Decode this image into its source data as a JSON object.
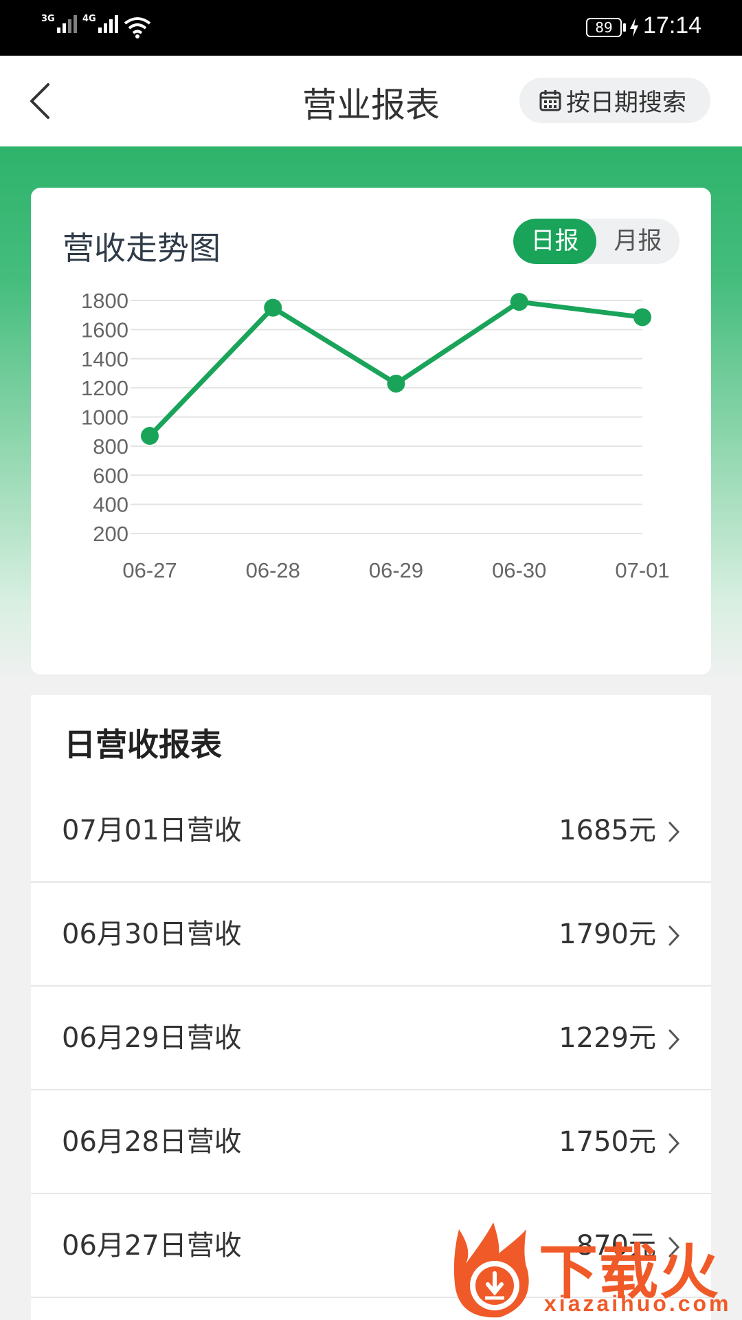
{
  "status_bar": {
    "network_1": "3G",
    "network_2": "4G",
    "battery": "89",
    "time": "17:14"
  },
  "header": {
    "title": "营业报表",
    "date_search_label": "按日期搜索"
  },
  "chart_card": {
    "title": "营收走势图",
    "toggle_daily": "日报",
    "toggle_monthly": "月报",
    "active_toggle": "日报"
  },
  "chart_data": {
    "type": "line",
    "title": "营收走势图",
    "categories": [
      "06-27",
      "06-28",
      "06-29",
      "06-30",
      "07-01"
    ],
    "values": [
      870,
      1750,
      1229,
      1790,
      1685
    ],
    "yticks": [
      200,
      400,
      600,
      800,
      1000,
      1200,
      1400,
      1600,
      1800
    ],
    "ylim": [
      200,
      1800
    ],
    "grid": true,
    "color": "#19a45a"
  },
  "list": {
    "title": "日营收报表",
    "rows": [
      {
        "label": "07月01日营收",
        "value": "1685元"
      },
      {
        "label": "06月30日营收",
        "value": "1790元"
      },
      {
        "label": "06月29日营收",
        "value": "1229元"
      },
      {
        "label": "06月28日营收",
        "value": "1750元"
      },
      {
        "label": "06月27日营收",
        "value": "870元"
      }
    ]
  },
  "watermark": {
    "brand": "下载火",
    "url": "xiazaihuo.com"
  },
  "colors": {
    "accent": "#19a45a",
    "header_green": "#2eb36b",
    "watermark": "#f05a28"
  }
}
